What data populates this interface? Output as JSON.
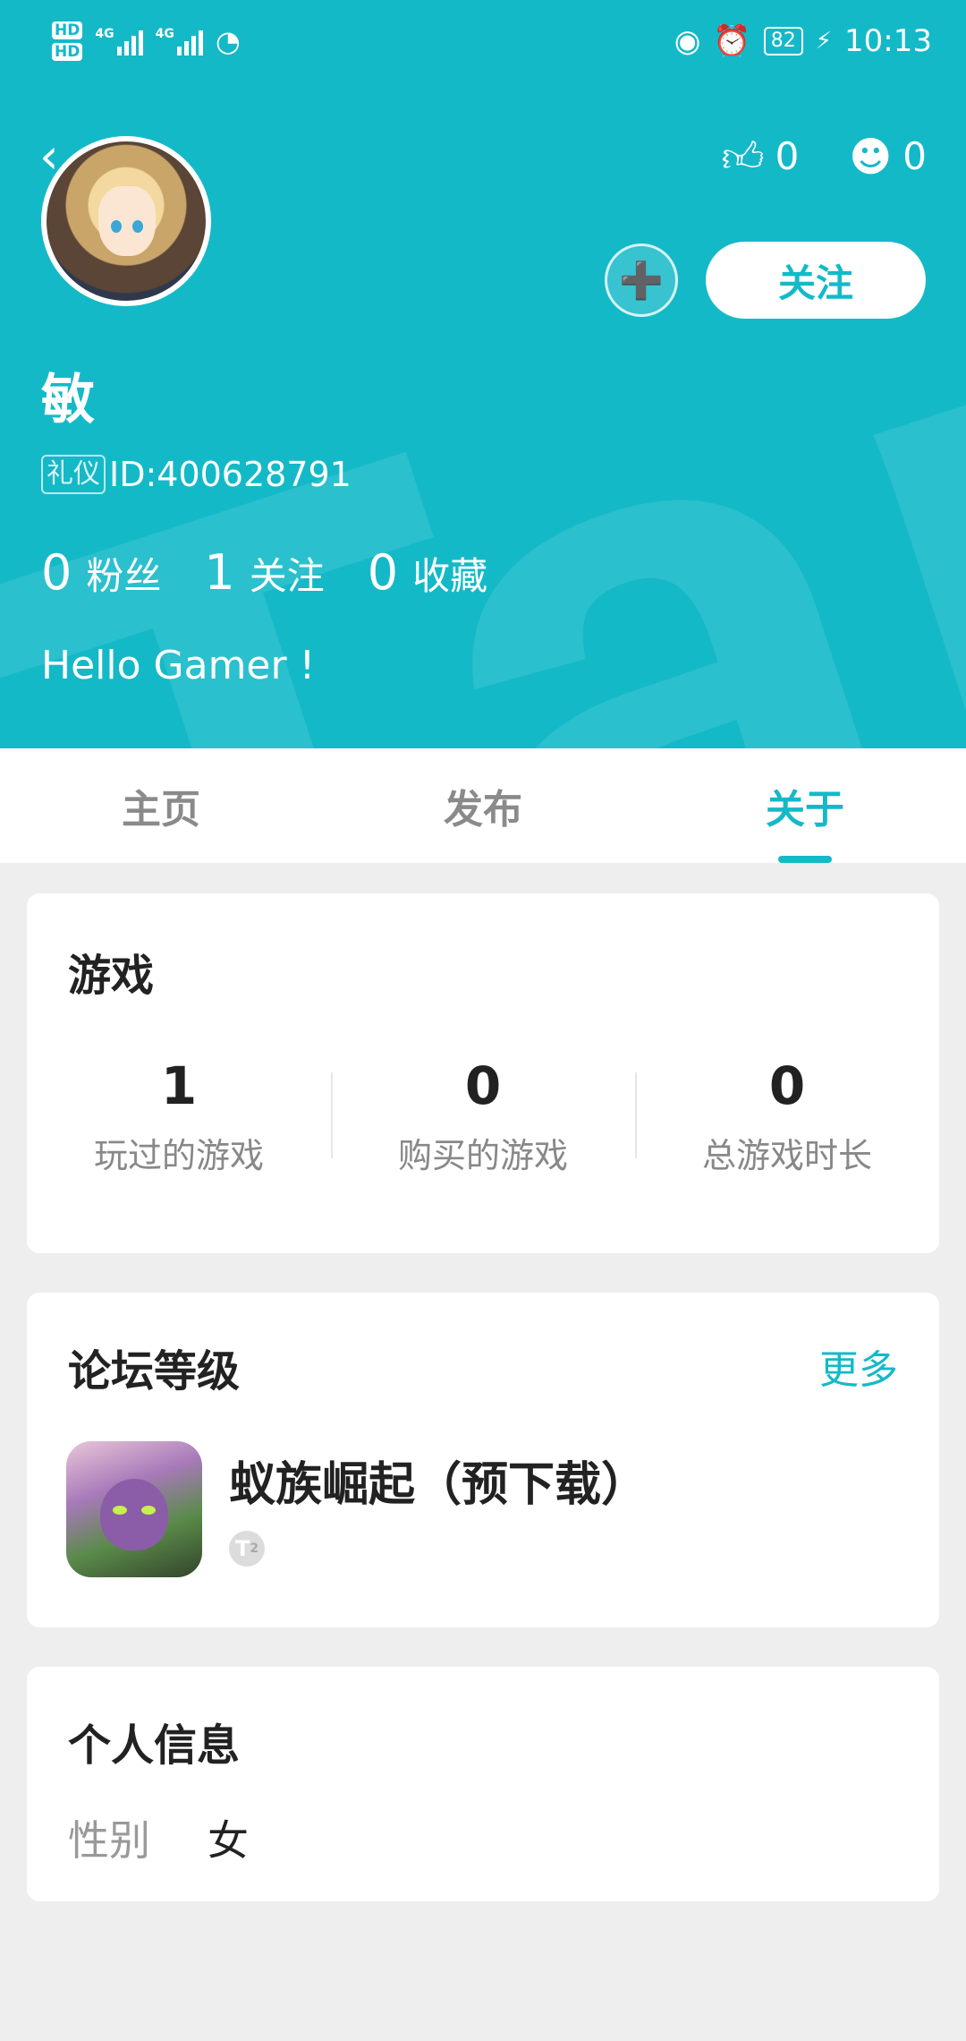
{
  "status_bar": {
    "sim1": "HD",
    "sim2": "HD",
    "net1": "4G",
    "net2": "4G",
    "battery": "82",
    "time": "10:13"
  },
  "profile": {
    "background_text": "TapTap",
    "name": "敏",
    "badge": "礼仪",
    "id": "ID:400628791",
    "likes": "0",
    "reactions": "0",
    "follow_label": "关注",
    "fans_count": "0",
    "fans_label": "粉丝",
    "following_count": "1",
    "following_label": "关注",
    "favorites_count": "0",
    "favorites_label": "收藏",
    "bio": "Hello Gamer !"
  },
  "tabs": [
    {
      "label": "主页",
      "active": false
    },
    {
      "label": "发布",
      "active": false
    },
    {
      "label": "关于",
      "active": true
    }
  ],
  "games": {
    "title": "游戏",
    "stats": [
      {
        "value": "1",
        "label": "玩过的游戏"
      },
      {
        "value": "0",
        "label": "购买的游戏"
      },
      {
        "value": "0",
        "label": "总游戏时长"
      }
    ]
  },
  "forum": {
    "title": "论坛等级",
    "more": "更多",
    "game_name": "蚁族崛起（预下载）",
    "level_badge": "T",
    "level_num": "2"
  },
  "personal": {
    "title": "个人信息",
    "gender_key": "性别",
    "gender_val": "女"
  },
  "colors": {
    "accent": "#14b9c8",
    "background": "#eeeeee"
  }
}
